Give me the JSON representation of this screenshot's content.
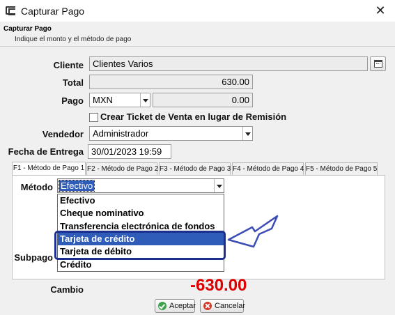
{
  "window": {
    "title": "Capturar Pago",
    "close_glyph": "✕"
  },
  "header": {
    "title": "Capturar Pago",
    "subtitle": "Indique el monto y el método de pago"
  },
  "form": {
    "cliente_label": "Cliente",
    "cliente_value": "Clientes Varios",
    "total_label": "Total",
    "total_value": "630.00",
    "pago_label": "Pago",
    "moneda_value": "MXN",
    "pago_value": "0.00",
    "ticket_checkbox_label": "Crear Ticket de Venta en lugar de Remisión",
    "ticket_checked": false,
    "vendedor_label": "Vendedor",
    "vendedor_value": "Administrador",
    "fecha_label": "Fecha de Entrega",
    "fecha_value": "30/01/2023 19:59"
  },
  "tabs": [
    {
      "label": "F1 - Método de Pago 1",
      "active": true
    },
    {
      "label": "F2 - Método de Pago 2",
      "active": false
    },
    {
      "label": "F3 - Método de Pago 3",
      "active": false
    },
    {
      "label": "F4 - Método de Pago 4",
      "active": false
    },
    {
      "label": "F5 - Método de Pago 5",
      "active": false
    }
  ],
  "payment": {
    "metodo_label": "Método",
    "metodo_value": "Efectivo",
    "subpago_label": "Subpago",
    "options": [
      {
        "label": "Efectivo",
        "highlighted": false
      },
      {
        "label": "Cheque nominativo",
        "highlighted": false
      },
      {
        "label": "Transferencia electrónica de fondos",
        "highlighted": false
      },
      {
        "label": "Tarjeta de crédito",
        "highlighted": true
      },
      {
        "label": "Tarjeta de débito",
        "highlighted": false
      },
      {
        "label": "Crédito",
        "highlighted": false
      }
    ]
  },
  "cambio": {
    "label": "Cambio",
    "value": "-630.00"
  },
  "buttons": {
    "accept_label": "Aceptar",
    "cancel_label": "Cancelar"
  },
  "colors": {
    "selection": "#2e5cb8",
    "callout": "#1c2f8e",
    "cambio": "#e00000",
    "arrow": "#3b4db5"
  },
  "icons": {
    "app": "app-window-icon",
    "close": "close-icon",
    "calendar": "calendar-icon",
    "accept": "check-icon",
    "cancel": "cancel-icon",
    "pointer": "arrow-pointer-icon"
  }
}
